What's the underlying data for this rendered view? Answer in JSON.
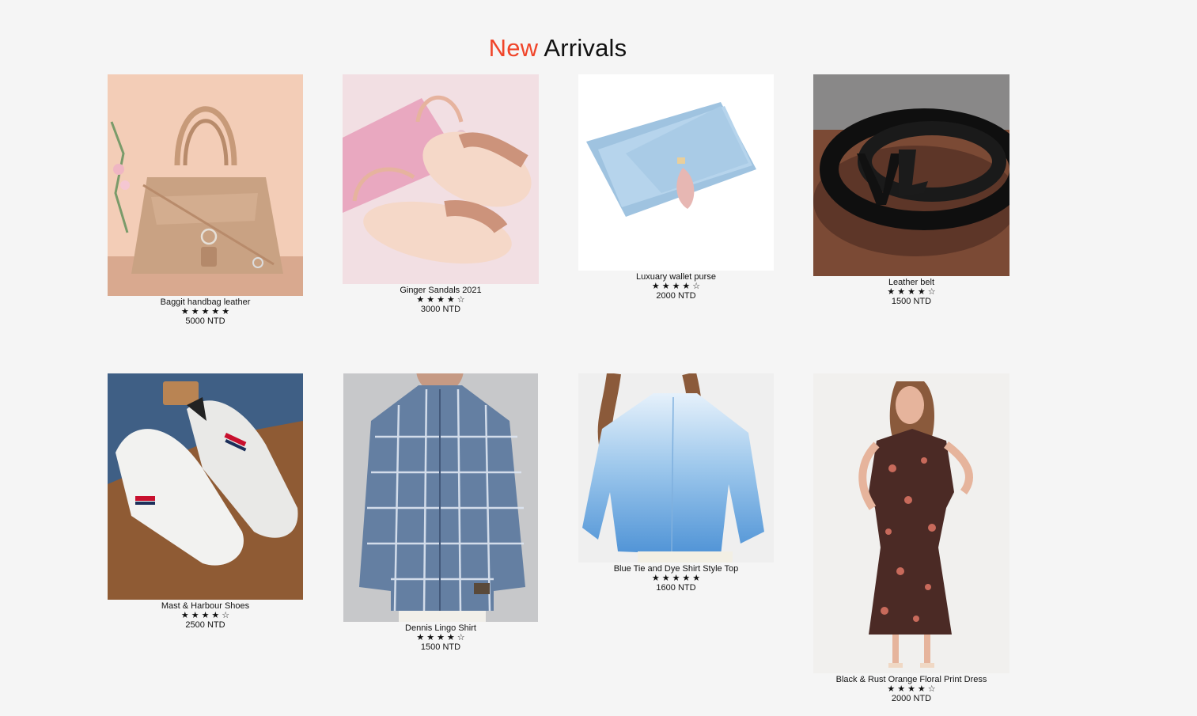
{
  "section": {
    "title_accent": "New",
    "title_rest": "Arrivals",
    "accent_color": "#f0452a"
  },
  "products": [
    {
      "name": "Baggit handbag leather",
      "stars": "★★★★★",
      "price": "5000 NTD",
      "image": "handbag"
    },
    {
      "name": "Ginger Sandals 2021",
      "stars": "★★★★☆",
      "price": "3000 NTD",
      "image": "sandals"
    },
    {
      "name": "Luxuary wallet purse",
      "stars": "★★★★☆",
      "price": "2000 NTD",
      "image": "wallet"
    },
    {
      "name": "Leather belt",
      "stars": "★★★★☆",
      "price": "1500 NTD",
      "image": "belt"
    },
    {
      "name": "Mast & Harbour Shoes",
      "stars": "★★★★☆",
      "price": "2500 NTD",
      "image": "sneakers"
    },
    {
      "name": "Dennis Lingo Shirt",
      "stars": "★★★★☆",
      "price": "1500 NTD",
      "image": "shirt"
    },
    {
      "name": "Blue Tie and Dye Shirt Style Top",
      "stars": "★★★★★",
      "price": "1600 NTD",
      "image": "top"
    },
    {
      "name": "Black & Rust Orange Floral Print Dress",
      "stars": "★★★★☆",
      "price": "2000 NTD",
      "image": "dress"
    }
  ]
}
